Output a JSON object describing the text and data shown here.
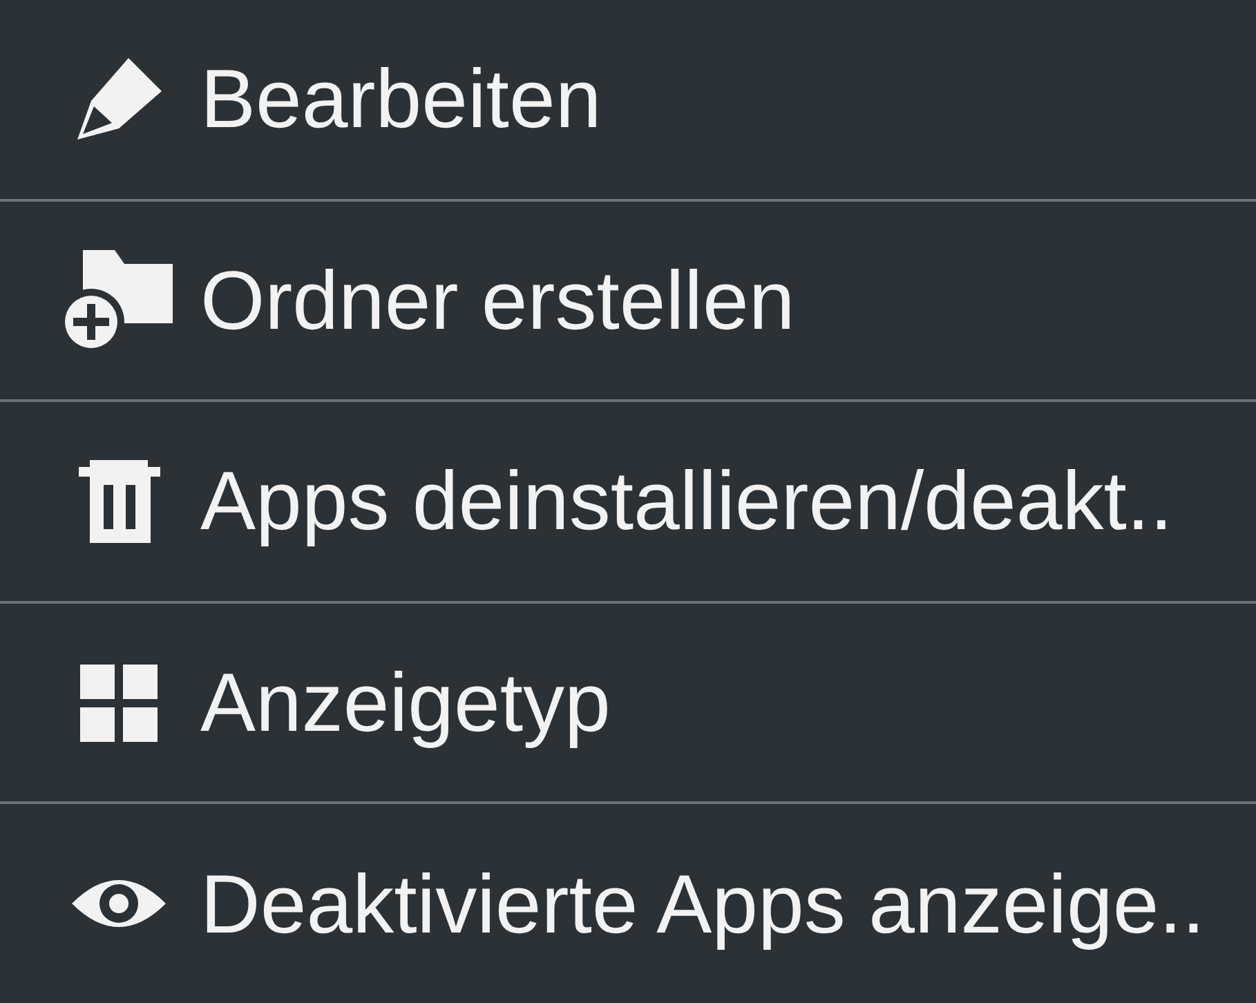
{
  "menu": {
    "items": [
      {
        "label": "Bearbeiten"
      },
      {
        "label": "Ordner erstellen"
      },
      {
        "label": "Apps deinstallieren/deakt.."
      },
      {
        "label": "Anzeigetyp"
      },
      {
        "label": "Deaktivierte Apps anzeige.."
      }
    ]
  }
}
